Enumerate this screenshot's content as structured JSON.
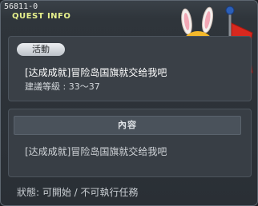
{
  "window": {
    "quest_id": "56811-0",
    "title": "QUEST INFO"
  },
  "summary": {
    "tag": "活動",
    "quest_name": "[达成成就]冒险岛国旗就交给我吧",
    "level_requirement": "建議等級 : 33〜37"
  },
  "content": {
    "header": "內容",
    "text": "[达成成就]冒险岛国旗就交给我吧"
  },
  "status": {
    "text": "狀態:  可開始 / 不可執行任務"
  },
  "colors": {
    "title_accent": "#e6f08c",
    "flag_red": "#d8281e",
    "npc_hair": "#f4b82a"
  },
  "icons": {
    "npc": "npc-girl-with-bunny-ears-and-flag"
  }
}
